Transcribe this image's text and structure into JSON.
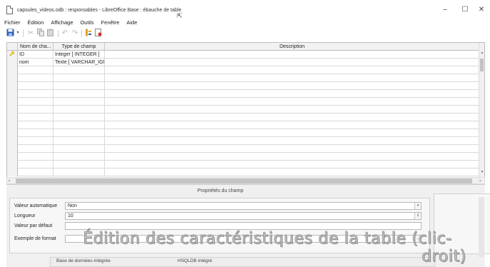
{
  "window": {
    "title": "capsules_videos.odb : responsables - LibreOffice Base : ébauche de table",
    "minimize": "–",
    "maximize": "☐",
    "close": "✕"
  },
  "menu": [
    "Fichier",
    "Édition",
    "Affichage",
    "Outils",
    "Fenêtre",
    "Aide"
  ],
  "toolbar": {
    "save_icon": "floppy-save-icon",
    "cut_icon": "scissors-cut-icon",
    "copy_icon": "copy-icon",
    "paste_icon": "paste-icon",
    "undo_icon": "undo-icon",
    "redo_icon": "redo-icon",
    "primary_key_icon": "primary-key-icon",
    "index_icon": "index-design-icon"
  },
  "grid": {
    "headers": [
      "Nom de cha...",
      "Type de champ",
      "Description"
    ],
    "rows": [
      {
        "marker": "🔑",
        "name": "ID",
        "type": "Integer [ INTEGER ]",
        "description": ""
      },
      {
        "marker": "",
        "name": "nom",
        "type": "Texte [ VARCHAR_IGN",
        "description": ""
      }
    ]
  },
  "properties": {
    "title": "Propriétés du champ",
    "fields": [
      {
        "label": "Valeur automatique",
        "value": "Non",
        "control": "dropdown"
      },
      {
        "label": "Longueur",
        "value": "10",
        "control": "spin"
      },
      {
        "label": "Valeur par défaut",
        "value": "",
        "control": "none"
      },
      {
        "label": "Exemple de format",
        "value": "",
        "control": "button"
      }
    ]
  },
  "bottom_strip": {
    "left": "Base de données intégrée",
    "right": "HSQLDB intégré"
  },
  "caption": {
    "line1": "Édition des caractéristiques de la table (clic-",
    "line2": "droit)"
  },
  "colors": {
    "accent": "#1f5fb6",
    "grid_border": "#bcbcbc",
    "panel_bg": "#f0f0f0"
  }
}
